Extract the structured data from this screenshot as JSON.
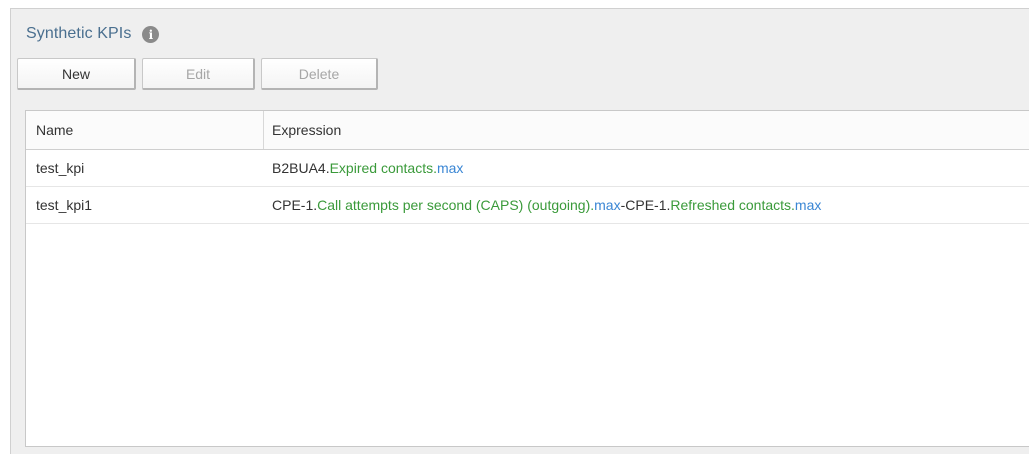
{
  "panel": {
    "title": "Synthetic KPIs",
    "info_icon": "info-icon"
  },
  "toolbar": {
    "new_label": "New",
    "edit_label": "Edit",
    "delete_label": "Delete"
  },
  "grid": {
    "columns": [
      "Name",
      "Expression"
    ],
    "rows": [
      {
        "name": "test_kpi",
        "expression": [
          {
            "text": "B2BUA4.",
            "kind": "entity"
          },
          {
            "text": "Expired contacts",
            "kind": "metric"
          },
          {
            "text": ".",
            "kind": "metric"
          },
          {
            "text": "max",
            "kind": "agg"
          }
        ]
      },
      {
        "name": "test_kpi1",
        "expression": [
          {
            "text": "CPE-1.",
            "kind": "entity"
          },
          {
            "text": "Call attempts per second (CAPS) (outgoing)",
            "kind": "metric"
          },
          {
            "text": ".",
            "kind": "metric"
          },
          {
            "text": "max",
            "kind": "agg"
          },
          {
            "text": "-CPE-1.",
            "kind": "entity"
          },
          {
            "text": "Refreshed contacts",
            "kind": "metric"
          },
          {
            "text": ".",
            "kind": "metric"
          },
          {
            "text": "max",
            "kind": "agg"
          }
        ]
      }
    ]
  },
  "colors": {
    "title": "#4a6f8f",
    "metric": "#3a9a3a",
    "aggregate": "#3a86d4",
    "disabled_text": "#a6a6a6"
  }
}
